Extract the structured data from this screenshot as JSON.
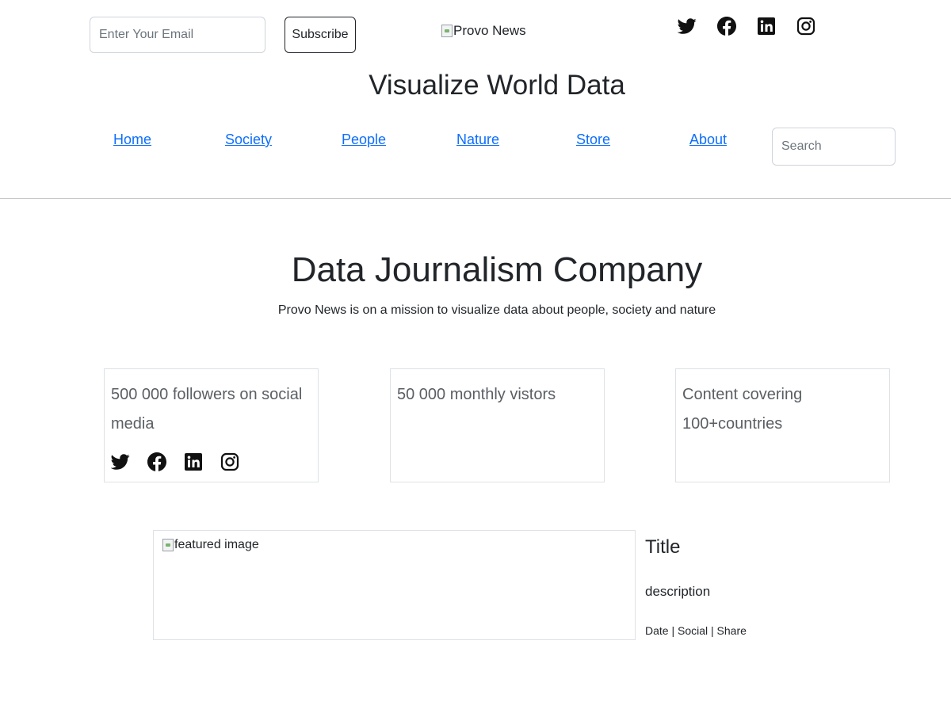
{
  "header": {
    "email_placeholder": "Enter Your Email",
    "subscribe_label": "Subscribe",
    "logo_alt": "Provo News",
    "social_icons": [
      "twitter-icon",
      "facebook-icon",
      "linkedin-icon",
      "instagram-icon"
    ],
    "site_title": "Visualize World Data"
  },
  "nav": {
    "items": [
      {
        "label": "Home"
      },
      {
        "label": "Society"
      },
      {
        "label": "People"
      },
      {
        "label": "Nature"
      },
      {
        "label": "Store"
      },
      {
        "label": "About"
      }
    ],
    "search_placeholder": "Search"
  },
  "hero": {
    "title": "Data Journalism Company",
    "subtitle": "Provo News is on a mission to visualize data about people, society and nature"
  },
  "stats": [
    {
      "text": "500 000 followers on social media"
    },
    {
      "text": "50 000 monthly vistors"
    },
    {
      "text": "Content covering 100+countries"
    }
  ],
  "featured": {
    "image_alt": "featured image",
    "title": "Title",
    "description": "description",
    "meta": "Date | Social | Share"
  },
  "colors": {
    "link": "#0d6efd",
    "text": "#212529",
    "border": "#dee2e6",
    "stat_text": "#5a5f64"
  }
}
